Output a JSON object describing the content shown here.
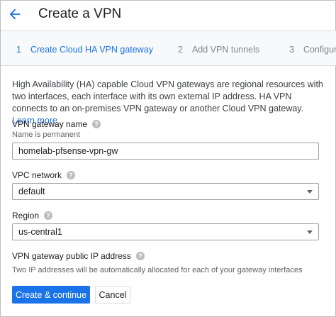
{
  "header": {
    "title": "Create a VPN",
    "back_icon": "arrow-back-icon"
  },
  "stepper": {
    "steps": [
      {
        "number": "1",
        "label": "Create Cloud HA VPN gateway",
        "active": true
      },
      {
        "number": "2",
        "label": "Add VPN tunnels",
        "active": false
      },
      {
        "number": "3",
        "label": "Configure",
        "active": false
      }
    ]
  },
  "description": {
    "text": "High Availability (HA) capable Cloud VPN gateways are regional resources with two interfaces, each interface with its own external IP address. HA VPN connects to an on-premises VPN gateway or another Cloud VPN gateway.",
    "link": "Learn more"
  },
  "gateway_name": {
    "label": "VPN gateway name",
    "hint": "Name is permanent",
    "value": "homelab-pfsense-vpn-gw",
    "help_icon": "help-icon"
  },
  "vpc_network": {
    "label": "VPC network",
    "value": "default",
    "help_icon": "help-icon"
  },
  "region": {
    "label": "Region",
    "value": "us-central1",
    "help_icon": "help-icon"
  },
  "public_ip": {
    "label": "VPN gateway public IP address",
    "hint": "Two IP addresses will be automatically allocated for each of your gateway interfaces",
    "help_icon": "help-icon"
  },
  "actions": {
    "create_label": "Create & continue",
    "cancel_label": "Cancel"
  },
  "colors": {
    "accent": "#1a73e8",
    "text": "#202124",
    "muted": "#80868b"
  }
}
